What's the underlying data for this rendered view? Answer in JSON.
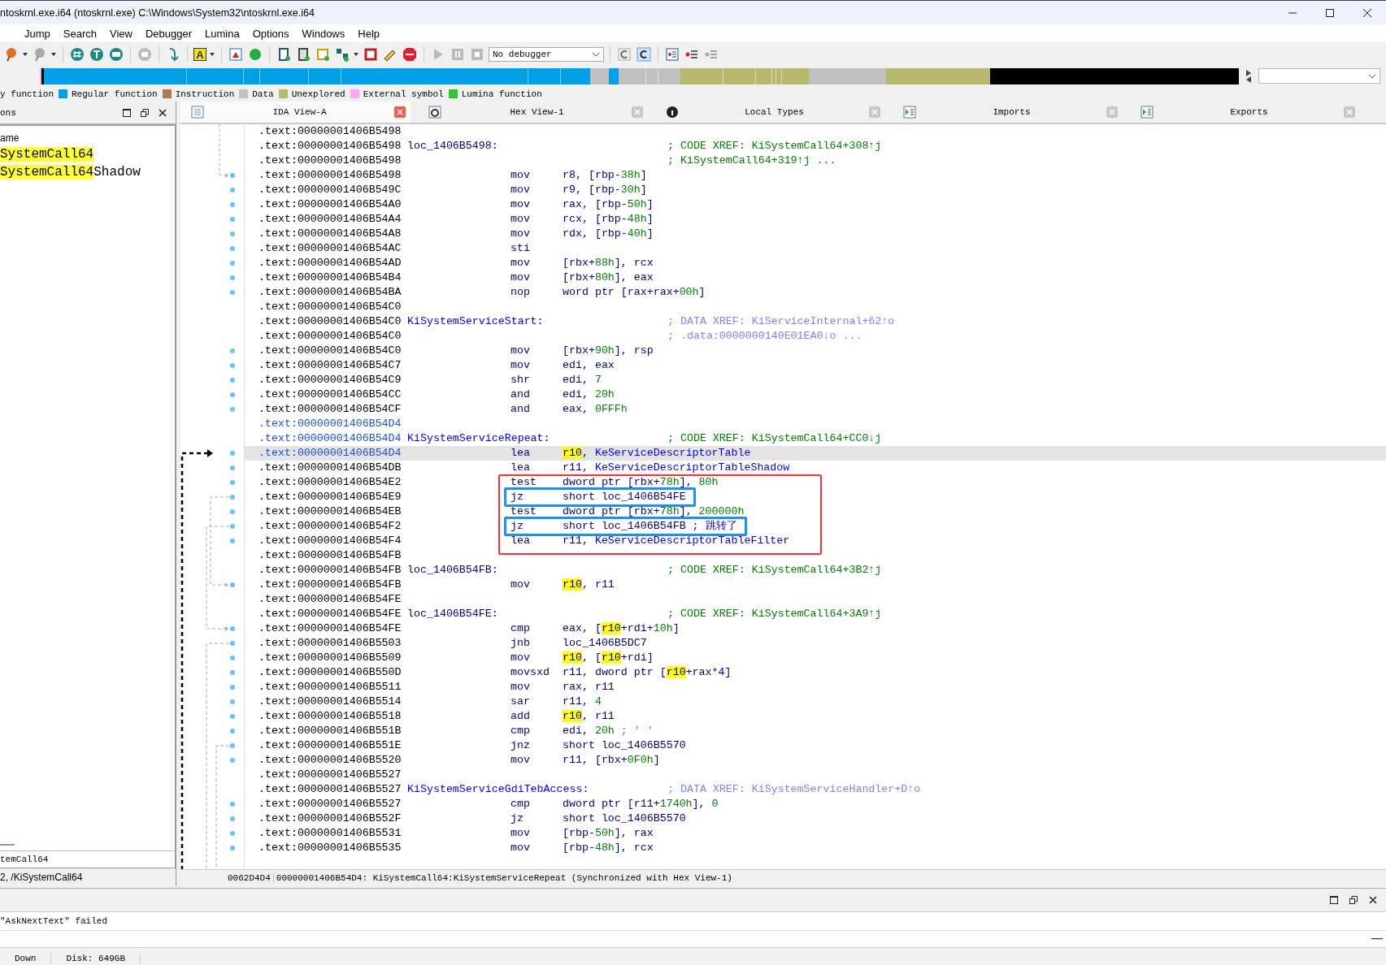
{
  "window": {
    "title": "ntoskrnl.exe.i64 (ntoskrnl.exe) C:\\Windows\\System32\\ntoskrnl.exe.i64"
  },
  "menu": [
    "Jump",
    "Search",
    "View",
    "Debugger",
    "Lumina",
    "Options",
    "Windows",
    "Help"
  ],
  "toolbar": {
    "letter_button": "A",
    "debugger_select": "No debugger"
  },
  "legend": [
    {
      "label": "y function"
    },
    {
      "label": "Regular function",
      "color": "#00a0e8"
    },
    {
      "label": "Instruction",
      "color": "#b07850"
    },
    {
      "label": "Data",
      "color": "#c0c0c0"
    },
    {
      "label": "Unexplored",
      "color": "#b8b86c"
    },
    {
      "label": "External symbol",
      "color": "#ffa8f0"
    },
    {
      "label": "Lumina function",
      "color": "#30c830"
    }
  ],
  "functions_panel": {
    "title": "ons",
    "column": "ame",
    "items": [
      [
        {
          "text": "SystemCall64",
          "highlighted": true
        }
      ],
      [
        {
          "text": "SystemCall64",
          "highlighted": true
        },
        {
          "text": "Shadow",
          "highlighted": false
        }
      ]
    ],
    "filter": "temCall64",
    "path": "2, /KiSystemCall64"
  },
  "tabs": [
    {
      "label": "IDA View-A",
      "selected": true
    },
    {
      "label": "Hex View-1",
      "selected": false
    },
    {
      "label": "Local Types",
      "selected": false
    },
    {
      "label": "Imports",
      "selected": false
    },
    {
      "label": "Exports",
      "selected": false
    }
  ],
  "lines": [
    {
      "kind": "line",
      "address": ".text:00000001406B5498",
      "current": false,
      "emphasized": false
    },
    {
      "kind": "line",
      "address": ".text:00000001406B5498",
      "label": {
        "text": "loc_1406B5498:",
        "kind": "local"
      },
      "comment": {
        "text": "; CODE XREF: KiSystemCall64+308↑j",
        "kind": "code_xref"
      },
      "current": false,
      "emphasized": false
    },
    {
      "kind": "line",
      "address": ".text:00000001406B5498",
      "comment": {
        "text": "; KiSystemCall64+319↑j ...",
        "kind": "code_xref"
      },
      "current": false,
      "emphasized": false
    },
    {
      "kind": "line",
      "address": ".text:00000001406B5498",
      "mnemonic": "mov",
      "operands": [
        {
          "text": "r8, [rbp-",
          "kind": "plain"
        },
        {
          "text": "38h",
          "kind": "number"
        },
        {
          "text": "]",
          "kind": "plain"
        }
      ],
      "current": false,
      "emphasized": false
    },
    {
      "kind": "line",
      "address": ".text:00000001406B549C",
      "mnemonic": "mov",
      "operands": [
        {
          "text": "r9, [rbp-",
          "kind": "plain"
        },
        {
          "text": "30h",
          "kind": "number"
        },
        {
          "text": "]",
          "kind": "plain"
        }
      ],
      "current": false,
      "emphasized": false
    },
    {
      "kind": "line",
      "address": ".text:00000001406B54A0",
      "mnemonic": "mov",
      "operands": [
        {
          "text": "rax, [rbp-",
          "kind": "plain"
        },
        {
          "text": "50h",
          "kind": "number"
        },
        {
          "text": "]",
          "kind": "plain"
        }
      ],
      "current": false,
      "emphasized": false
    },
    {
      "kind": "line",
      "address": ".text:00000001406B54A4",
      "mnemonic": "mov",
      "operands": [
        {
          "text": "rcx, [rbp-",
          "kind": "plain"
        },
        {
          "text": "48h",
          "kind": "number"
        },
        {
          "text": "]",
          "kind": "plain"
        }
      ],
      "current": false,
      "emphasized": false
    },
    {
      "kind": "line",
      "address": ".text:00000001406B54A8",
      "mnemonic": "mov",
      "operands": [
        {
          "text": "rdx, [rbp-",
          "kind": "plain"
        },
        {
          "text": "40h",
          "kind": "number"
        },
        {
          "text": "]",
          "kind": "plain"
        }
      ],
      "current": false,
      "emphasized": false
    },
    {
      "kind": "line",
      "address": ".text:00000001406B54AC",
      "mnemonic": "sti",
      "current": false,
      "emphasized": false
    },
    {
      "kind": "line",
      "address": ".text:00000001406B54AD",
      "mnemonic": "mov",
      "operands": [
        {
          "text": "[rbx+",
          "kind": "plain"
        },
        {
          "text": "88h",
          "kind": "number"
        },
        {
          "text": "], rcx",
          "kind": "plain"
        }
      ],
      "current": false,
      "emphasized": false
    },
    {
      "kind": "line",
      "address": ".text:00000001406B54B4",
      "mnemonic": "mov",
      "operands": [
        {
          "text": "[rbx+",
          "kind": "plain"
        },
        {
          "text": "80h",
          "kind": "number"
        },
        {
          "text": "], eax",
          "kind": "plain"
        }
      ],
      "current": false,
      "emphasized": false
    },
    {
      "kind": "line",
      "address": ".text:00000001406B54BA",
      "mnemonic": "nop",
      "operands": [
        {
          "text": "word ptr [rax+rax+",
          "kind": "plain"
        },
        {
          "text": "00h",
          "kind": "number"
        },
        {
          "text": "]",
          "kind": "plain"
        }
      ],
      "current": false,
      "emphasized": false
    },
    {
      "kind": "line",
      "address": ".text:00000001406B54C0",
      "current": false,
      "emphasized": false
    },
    {
      "kind": "line",
      "address": ".text:00000001406B54C0",
      "label": {
        "text": "KiSystemServiceStart:",
        "kind": "public"
      },
      "comment": {
        "text": "; DATA XREF: KiServiceInternal+62↑o",
        "kind": "data_xref"
      },
      "current": false,
      "emphasized": false
    },
    {
      "kind": "line",
      "address": ".text:00000001406B54C0",
      "comment": {
        "text": "; .data:0000000140E01EA0↓o ...",
        "kind": "data_xref"
      },
      "current": false,
      "emphasized": false
    },
    {
      "kind": "line",
      "address": ".text:00000001406B54C0",
      "mnemonic": "mov",
      "operands": [
        {
          "text": "[rbx+",
          "kind": "plain"
        },
        {
          "text": "90h",
          "kind": "number"
        },
        {
          "text": "], rsp",
          "kind": "plain"
        }
      ],
      "current": false,
      "emphasized": false
    },
    {
      "kind": "line",
      "address": ".text:00000001406B54C7",
      "mnemonic": "mov",
      "operands": [
        {
          "text": "edi, eax",
          "kind": "plain"
        }
      ],
      "current": false,
      "emphasized": false
    },
    {
      "kind": "line",
      "address": ".text:00000001406B54C9",
      "mnemonic": "shr",
      "operands": [
        {
          "text": "edi, ",
          "kind": "plain"
        },
        {
          "text": "7",
          "kind": "number"
        }
      ],
      "current": false,
      "emphasized": false
    },
    {
      "kind": "line",
      "address": ".text:00000001406B54CC",
      "mnemonic": "and",
      "operands": [
        {
          "text": "edi, ",
          "kind": "plain"
        },
        {
          "text": "20h",
          "kind": "number"
        }
      ],
      "current": false,
      "emphasized": false
    },
    {
      "kind": "line",
      "address": ".text:00000001406B54CF",
      "mnemonic": "and",
      "operands": [
        {
          "text": "eax, ",
          "kind": "plain"
        },
        {
          "text": "0FFFh",
          "kind": "number"
        }
      ],
      "current": false,
      "emphasized": false
    },
    {
      "kind": "line",
      "address": ".text:00000001406B54D4",
      "current": false,
      "emphasized": true
    },
    {
      "kind": "line",
      "address": ".text:00000001406B54D4",
      "label": {
        "text": "KiSystemServiceRepeat:",
        "kind": "public"
      },
      "comment": {
        "text": "; CODE XREF: KiSystemCall64+CC0↓j",
        "kind": "code_xref"
      },
      "current": false,
      "emphasized": true
    },
    {
      "kind": "line",
      "address": ".text:00000001406B54D4",
      "mnemonic": "lea",
      "operands": [
        {
          "text": "r10",
          "kind": "marked"
        },
        {
          "text": ", ",
          "kind": "plain"
        },
        {
          "text": "KeServiceDescriptorTable",
          "kind": "symbol"
        }
      ],
      "current": true,
      "emphasized": true
    },
    {
      "kind": "line",
      "address": ".text:00000001406B54DB",
      "mnemonic": "lea",
      "operands": [
        {
          "text": "r11, ",
          "kind": "plain"
        },
        {
          "text": "KeServiceDescriptorTableShadow",
          "kind": "symbol"
        }
      ],
      "current": false,
      "emphasized": false
    },
    {
      "kind": "boxed_group",
      "lines": [
        {
          "address": ".text:00000001406B54E2",
          "mnemonic": "test",
          "operands": [
            {
              "text": "dword ptr [rbx+",
              "kind": "plain"
            },
            {
              "text": "78h",
              "kind": "number"
            },
            {
              "text": "], ",
              "kind": "plain"
            },
            {
              "text": "80h",
              "kind": "number"
            }
          ],
          "emphasized": false,
          "circled": false
        },
        {
          "address": ".text:00000001406B54E9",
          "mnemonic": "jz",
          "operands": [
            {
              "text": "short loc_1406B54FE",
              "kind": "plain"
            }
          ],
          "emphasized": false,
          "circled": true
        },
        {
          "address": ".text:00000001406B54EB",
          "mnemonic": "test",
          "operands": [
            {
              "text": "dword ptr [rbx+",
              "kind": "plain"
            },
            {
              "text": "78h",
              "kind": "number"
            },
            {
              "text": "], ",
              "kind": "plain"
            },
            {
              "text": "200000h",
              "kind": "number"
            }
          ],
          "emphasized": false,
          "circled": false
        },
        {
          "address": ".text:00000001406B54F2",
          "mnemonic": "jz",
          "operands": [
            {
              "text": "short loc_1406B54FB",
              "kind": "plain"
            }
          ],
          "comment": {
            "text": "; 跳转了",
            "kind": "note"
          },
          "emphasized": false,
          "circled": true
        },
        {
          "address": ".text:00000001406B54F4",
          "mnemonic": "lea",
          "operands": [
            {
              "text": "r11, ",
              "kind": "plain"
            },
            {
              "text": "KeServiceDescriptorTableFilter",
              "kind": "symbol"
            }
          ],
          "emphasized": false,
          "circled": false
        }
      ]
    },
    {
      "kind": "line",
      "address": ".text:00000001406B54FB",
      "current": false,
      "emphasized": false
    },
    {
      "kind": "line",
      "address": ".text:00000001406B54FB",
      "label": {
        "text": "loc_1406B54FB:",
        "kind": "local"
      },
      "comment": {
        "text": "; CODE XREF: KiSystemCall64+3B2↑j",
        "kind": "code_xref"
      },
      "current": false,
      "emphasized": false
    },
    {
      "kind": "line",
      "address": ".text:00000001406B54FB",
      "mnemonic": "mov",
      "operands": [
        {
          "text": "r10",
          "kind": "marked"
        },
        {
          "text": ", r11",
          "kind": "plain"
        }
      ],
      "current": false,
      "emphasized": false
    },
    {
      "kind": "line",
      "address": ".text:00000001406B54FE",
      "current": false,
      "emphasized": false
    },
    {
      "kind": "line",
      "address": ".text:00000001406B54FE",
      "label": {
        "text": "loc_1406B54FE:",
        "kind": "local"
      },
      "comment": {
        "text": "; CODE XREF: KiSystemCall64+3A9↑j",
        "kind": "code_xref"
      },
      "current": false,
      "emphasized": false
    },
    {
      "kind": "line",
      "address": ".text:00000001406B54FE",
      "mnemonic": "cmp",
      "operands": [
        {
          "text": "eax, [",
          "kind": "plain"
        },
        {
          "text": "r10",
          "kind": "marked"
        },
        {
          "text": "+rdi+",
          "kind": "plain"
        },
        {
          "text": "10h",
          "kind": "number"
        },
        {
          "text": "]",
          "kind": "plain"
        }
      ],
      "current": false,
      "emphasized": false
    },
    {
      "kind": "line",
      "address": ".text:00000001406B5503",
      "mnemonic": "jnb",
      "operands": [
        {
          "text": "loc_1406B5DC7",
          "kind": "plain"
        }
      ],
      "current": false,
      "emphasized": false
    },
    {
      "kind": "line",
      "address": ".text:00000001406B5509",
      "mnemonic": "mov",
      "operands": [
        {
          "text": "r10",
          "kind": "marked"
        },
        {
          "text": ", [",
          "kind": "plain"
        },
        {
          "text": "r10",
          "kind": "marked"
        },
        {
          "text": "+rdi]",
          "kind": "plain"
        }
      ],
      "current": false,
      "emphasized": false
    },
    {
      "kind": "line",
      "address": ".text:00000001406B550D",
      "mnemonic": "movsxd",
      "operands": [
        {
          "text": "r11, dword ptr [",
          "kind": "plain"
        },
        {
          "text": "r10",
          "kind": "marked"
        },
        {
          "text": "+rax*4]",
          "kind": "plain"
        }
      ],
      "current": false,
      "emphasized": false
    },
    {
      "kind": "line",
      "address": ".text:00000001406B5511",
      "mnemonic": "mov",
      "operands": [
        {
          "text": "rax, r11",
          "kind": "plain"
        }
      ],
      "current": false,
      "emphasized": false
    },
    {
      "kind": "line",
      "address": ".text:00000001406B5514",
      "mnemonic": "sar",
      "operands": [
        {
          "text": "r11, ",
          "kind": "plain"
        },
        {
          "text": "4",
          "kind": "number"
        }
      ],
      "current": false,
      "emphasized": false
    },
    {
      "kind": "line",
      "address": ".text:00000001406B5518",
      "mnemonic": "add",
      "operands": [
        {
          "text": "r10",
          "kind": "marked"
        },
        {
          "text": ", r11",
          "kind": "plain"
        }
      ],
      "current": false,
      "emphasized": false
    },
    {
      "kind": "line",
      "address": ".text:00000001406B551B",
      "mnemonic": "cmp",
      "operands": [
        {
          "text": "edi, ",
          "kind": "plain"
        },
        {
          "text": "20h",
          "kind": "number"
        }
      ],
      "comment": {
        "text": "; ' '",
        "kind": "inline"
      },
      "current": false,
      "emphasized": false
    },
    {
      "kind": "line",
      "address": ".text:00000001406B551E",
      "mnemonic": "jnz",
      "operands": [
        {
          "text": "short loc_1406B5570",
          "kind": "plain"
        }
      ],
      "current": false,
      "emphasized": false
    },
    {
      "kind": "line",
      "address": ".text:00000001406B5520",
      "mnemonic": "mov",
      "operands": [
        {
          "text": "r11, [rbx+",
          "kind": "plain"
        },
        {
          "text": "0F0h",
          "kind": "number"
        },
        {
          "text": "]",
          "kind": "plain"
        }
      ],
      "current": false,
      "emphasized": false
    },
    {
      "kind": "line",
      "address": ".text:00000001406B5527",
      "current": false,
      "emphasized": false
    },
    {
      "kind": "line",
      "address": ".text:00000001406B5527",
      "label": {
        "text": "KiSystemServiceGdiTebAccess:",
        "kind": "public"
      },
      "comment": {
        "text": "; DATA XREF: KiSystemServiceHandler+D↑o",
        "kind": "data_xref"
      },
      "current": false,
      "emphasized": false
    },
    {
      "kind": "line",
      "address": ".text:00000001406B5527",
      "mnemonic": "cmp",
      "operands": [
        {
          "text": "dword ptr [r11+",
          "kind": "plain"
        },
        {
          "text": "1740h",
          "kind": "number"
        },
        {
          "text": "], ",
          "kind": "plain"
        },
        {
          "text": "0",
          "kind": "number"
        }
      ],
      "current": false,
      "emphasized": false
    },
    {
      "kind": "line",
      "address": ".text:00000001406B552F",
      "mnemonic": "jz",
      "operands": [
        {
          "text": "short loc_1406B5570",
          "kind": "plain"
        }
      ],
      "current": false,
      "emphasized": false
    },
    {
      "kind": "line",
      "address": ".text:00000001406B5531",
      "mnemonic": "mov",
      "operands": [
        {
          "text": "[rbp-",
          "kind": "plain"
        },
        {
          "text": "50h",
          "kind": "number"
        },
        {
          "text": "], rax",
          "kind": "plain"
        }
      ],
      "current": false,
      "emphasized": false
    },
    {
      "kind": "line",
      "address": ".text:00000001406B5535",
      "mnemonic": "mov",
      "operands": [
        {
          "text": "[rbp-",
          "kind": "plain"
        },
        {
          "text": "48h",
          "kind": "number"
        },
        {
          "text": "], rcx",
          "kind": "plain"
        }
      ],
      "current": false,
      "emphasized": false
    }
  ],
  "view_status": {
    "offset": "0062D4D4",
    "location": "00000001406B54D4: KiSystemCall64:KiSystemServiceRepeat (Synchronized with Hex View-1)"
  },
  "output": {
    "message": "\"AskNextText\" failed"
  },
  "status_bar": [
    "Down",
    "Disk: 649GB"
  ]
}
